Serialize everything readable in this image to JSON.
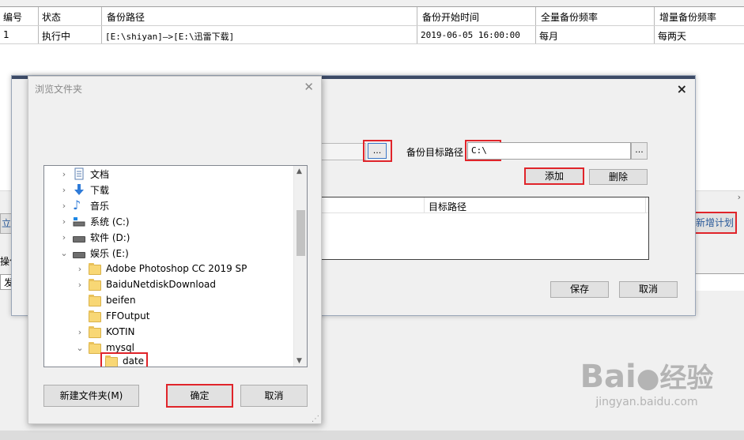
{
  "table": {
    "headers": [
      "编号",
      "状态",
      "备份路径",
      "备份开始时间",
      "全量备份频率",
      "增量备份频率"
    ],
    "rows": [
      [
        "1",
        "执行中",
        "[E:\\shiyan]—>[E:\\迅雷下载]",
        "2019-06-05 16:00:00",
        "每月",
        "每两天"
      ]
    ]
  },
  "background": {
    "left_btn_cut": "立即",
    "new_plan_label": "新增计划",
    "ops_label_cut": "操作",
    "row_cut": "发"
  },
  "backup_dialog": {
    "target_label": "备份目标路径",
    "target_value": "C:\\",
    "browse_dots": "...",
    "add_label": "添加",
    "delete_label": "删除",
    "list_col_target": "目标路径",
    "save_label": "保存",
    "cancel_label": "取消",
    "close_glyph": "×"
  },
  "browse_dialog": {
    "title": "浏览文件夹",
    "close_glyph": "✕",
    "tree": [
      {
        "label": "文档",
        "icon": "documents-icon",
        "expand": "›"
      },
      {
        "label": "下载",
        "icon": "download-icon",
        "expand": "›"
      },
      {
        "label": "音乐",
        "icon": "music-icon",
        "expand": "›"
      },
      {
        "label": "系统 (C:)",
        "icon": "system-drive-icon",
        "expand": "›"
      },
      {
        "label": "软件 (D:)",
        "icon": "drive-icon",
        "expand": "›"
      },
      {
        "label": "娱乐 (E:)",
        "icon": "drive-icon",
        "expand": "⌄"
      },
      {
        "label": "Adobe Photoshop CC 2019 SP",
        "icon": "folder-icon",
        "expand": "›"
      },
      {
        "label": "BaiduNetdiskDownload",
        "icon": "folder-icon",
        "expand": "›"
      },
      {
        "label": "beifen",
        "icon": "folder-icon",
        "expand": ""
      },
      {
        "label": "FFOutput",
        "icon": "folder-icon",
        "expand": ""
      },
      {
        "label": "KOTIN",
        "icon": "folder-icon",
        "expand": "›"
      },
      {
        "label": "mysql",
        "icon": "folder-icon",
        "expand": "⌄"
      },
      {
        "label": "date",
        "icon": "folder-icon",
        "expand": ""
      }
    ],
    "new_folder_label": "新建文件夹(M)",
    "ok_label": "确定",
    "cancel_label": "取消"
  },
  "watermark": {
    "brand": "Bai",
    "brand_suffix": "经验",
    "url": "jingyan.baidu.com"
  },
  "colors": {
    "highlight_red": "#e0242a",
    "dialog_topline": "#3c4a66",
    "folder_yellow": "#f8d775"
  }
}
